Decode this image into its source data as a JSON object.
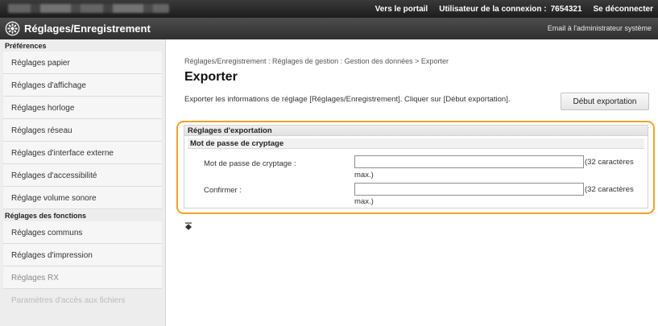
{
  "topbar": {
    "portal_link": "Vers le portail",
    "login_user_label": "Utilisateur de la connexion :",
    "login_user_id": "7654321",
    "logout_link": "Se déconnecter"
  },
  "header": {
    "title": "Réglages/Enregistrement",
    "admin_email_link": "Email à l'administrateur système",
    "icon": "gear-icon"
  },
  "sidebar": {
    "preferences_heading": "Préférences",
    "preferences_items": [
      "Réglages papier",
      "Réglages d'affichage",
      "Réglages horloge",
      "Réglages réseau",
      "Réglages d'interface externe",
      "Réglages d'accessibilité",
      "Réglage volume sonore"
    ],
    "functions_heading": "Réglages des fonctions",
    "functions_items": [
      "Réglages communs",
      "Réglages d'impression",
      "Réglages RX",
      "Paramètres d'accès aux fichiers"
    ]
  },
  "main": {
    "breadcrumb": "Réglages/Enregistrement : Réglages de gestion : Gestion des données > Exporter",
    "title": "Exporter",
    "description": "Exporter les informations de réglage [Réglages/Enregistrement]. Cliquer sur [Début exportation].",
    "start_button": "Début exportation",
    "panel_title": "Réglages d'exportation",
    "subsection_title": "Mot de passe de cryptage",
    "password_label": "Mot de passe de cryptage :",
    "password_value": "",
    "password_hint_line1": "(32 caractères",
    "password_hint_line2": "max.)",
    "confirm_label": "Confirmer :",
    "confirm_value": "",
    "confirm_hint_line1": "(32 caractères",
    "confirm_hint_line2": "max.)",
    "highlight_color": "#f0a22a"
  }
}
